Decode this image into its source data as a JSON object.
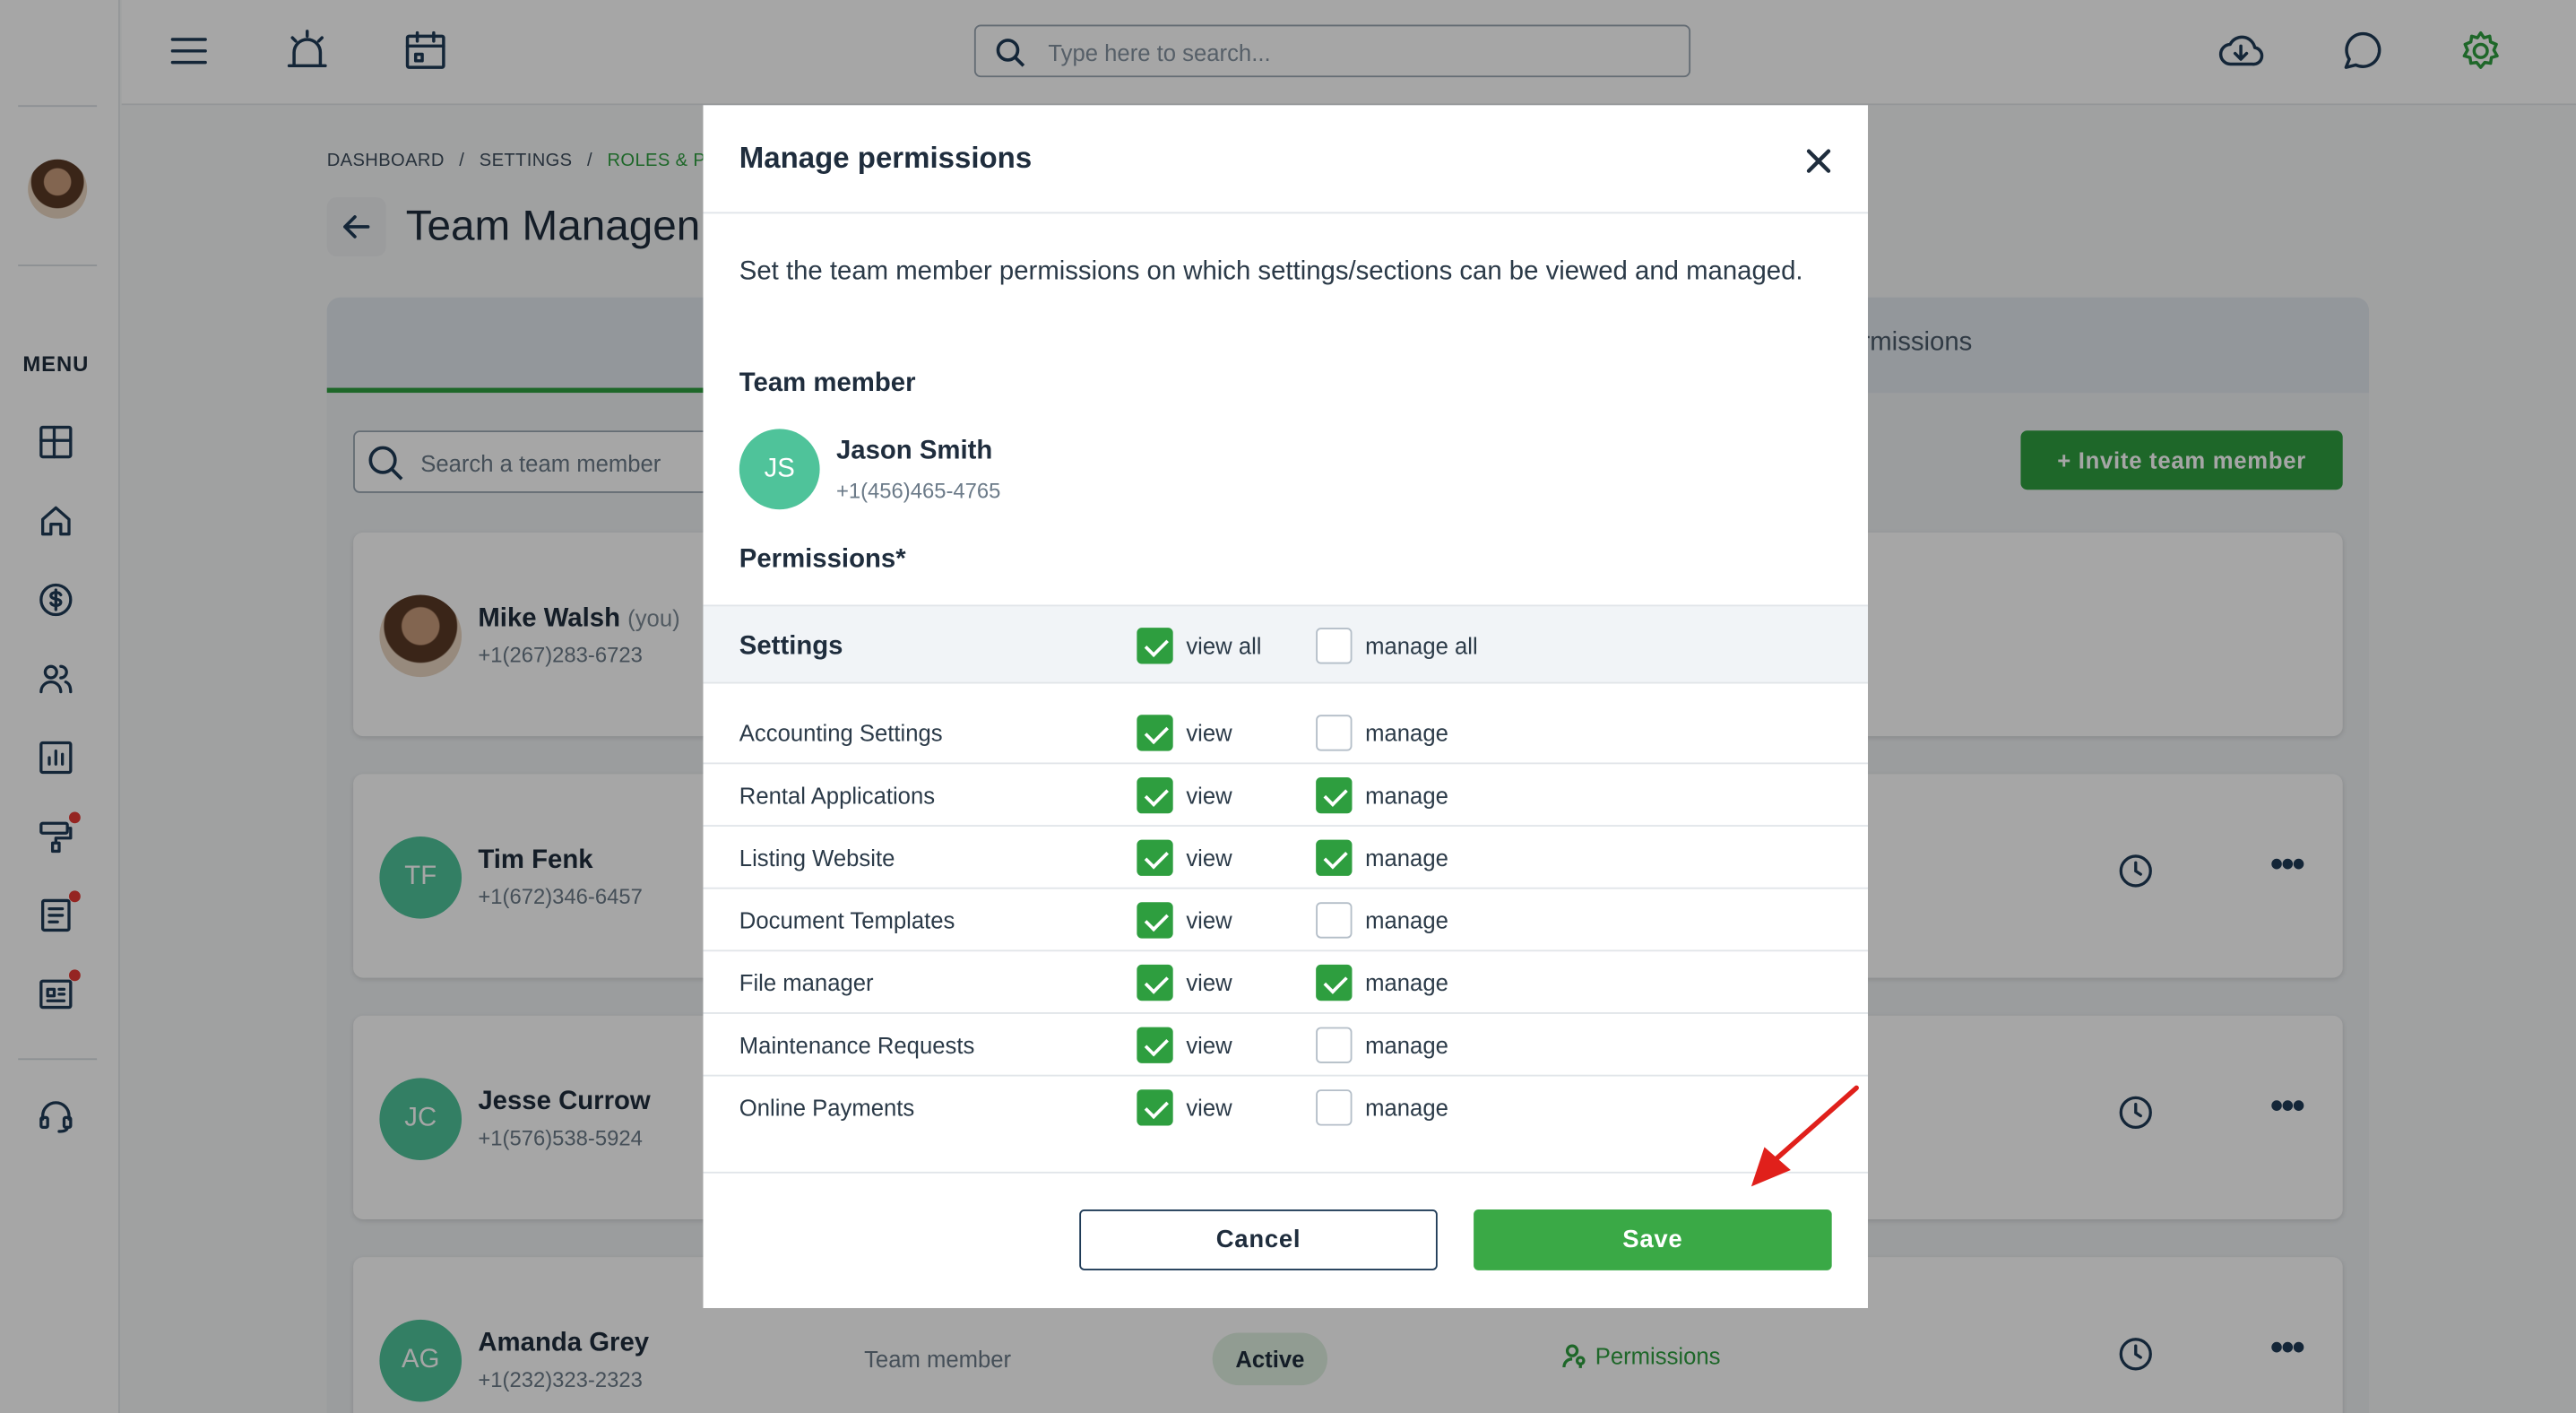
{
  "topbar": {
    "search_placeholder": "Type here to search..."
  },
  "sidebar": {
    "menu_label": "MENU"
  },
  "breadcrumb": {
    "items": [
      "DASHBOARD",
      "SETTINGS",
      "ROLES & PER"
    ]
  },
  "page": {
    "title": "Team Managen",
    "tab_permissions": "ermissions",
    "search_member_placeholder": "Search a team member",
    "invite_button": "+ Invite team member"
  },
  "members": [
    {
      "initials": "",
      "name": "Mike Walsh",
      "you": "(you)",
      "phone": "+1(267)283-6723"
    },
    {
      "initials": "TF",
      "name": "Tim Fenk",
      "phone": "+1(672)346-6457"
    },
    {
      "initials": "JC",
      "name": "Jesse Currow",
      "phone": "+1(576)538-5924"
    },
    {
      "initials": "AG",
      "name": "Amanda Grey",
      "phone": "+1(232)323-2323",
      "role": "Team member",
      "status": "Active",
      "permissions_link": "Permissions"
    }
  ],
  "modal": {
    "title": "Manage permissions",
    "description": "Set the team member permissions on which settings/sections can be viewed and managed.",
    "team_member_label": "Team member",
    "member": {
      "initials": "JS",
      "name": "Jason Smith",
      "phone": "+1(456)465-4765"
    },
    "permissions_label": "Permissions*",
    "section": {
      "name": "Settings",
      "view_all_label": "view all",
      "manage_all_label": "manage all",
      "view_all": true,
      "manage_all": false
    },
    "view_label": "view",
    "manage_label": "manage",
    "rows": [
      {
        "name": "Accounting Settings",
        "view": true,
        "manage": false
      },
      {
        "name": "Rental Applications",
        "view": true,
        "manage": true
      },
      {
        "name": "Listing Website",
        "view": true,
        "manage": true
      },
      {
        "name": "Document Templates",
        "view": true,
        "manage": false
      },
      {
        "name": "File manager",
        "view": true,
        "manage": true
      },
      {
        "name": "Maintenance Requests",
        "view": true,
        "manage": false
      },
      {
        "name": "Online Payments",
        "view": true,
        "manage": false
      }
    ],
    "cancel_label": "Cancel",
    "save_label": "Save"
  },
  "colors": {
    "accent": "#2e9e3f",
    "annotation_arrow": "#e0201b"
  }
}
